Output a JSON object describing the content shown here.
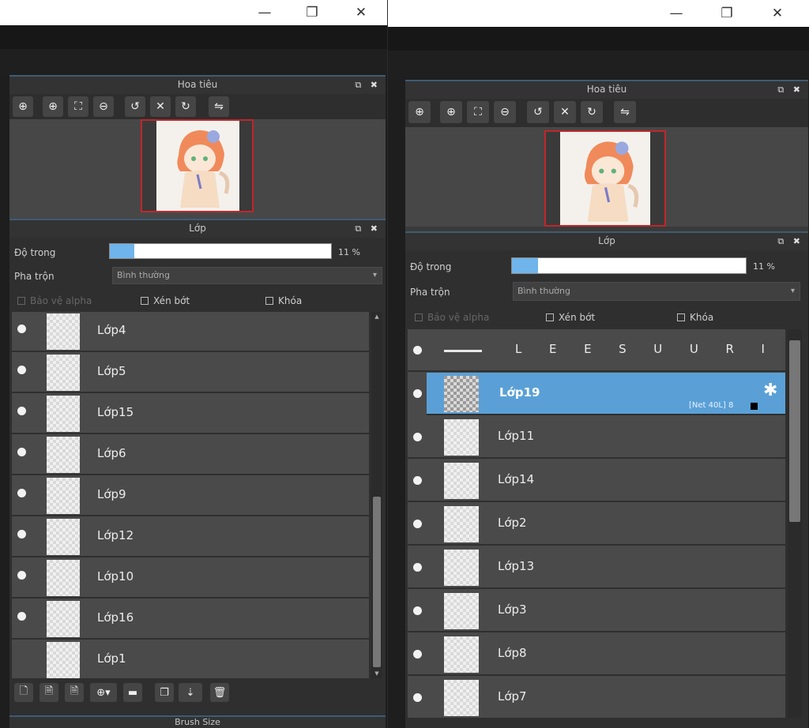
{
  "window_controls": {
    "minimize": "—",
    "maximize": "❐",
    "close": "✕"
  },
  "navigator": {
    "title": "Hoa tiêu",
    "panel_buttons": "⧉ ✖",
    "toolbar_icons": [
      "zoom-fit-icon",
      "zoom-in-icon",
      "fit-window-icon",
      "zoom-out-icon",
      "rotate-left-icon",
      "reset-view-icon",
      "rotate-right-icon",
      "flip-icon"
    ]
  },
  "layer_panel": {
    "title": "Lớp",
    "panel_buttons": "⧉ ✖",
    "opacity_label": "Độ trong",
    "opacity_value": "11 %",
    "opacity_fraction": 0.11,
    "blend_label": "Pha trộn",
    "blend_value": "Bình thường",
    "protect_alpha_label": "Bảo vệ alpha",
    "clip_label": "Xén bớt",
    "lock_label": "Khóa"
  },
  "left_layers": [
    "Lớp4",
    "Lớp5",
    "Lớp15",
    "Lớp6",
    "Lớp9",
    "Lớp12",
    "Lớp10",
    "Lớp16",
    "Lớp1"
  ],
  "right_group": {
    "name_letters": [
      "L",
      "E",
      "E",
      "S",
      "U",
      "U",
      "R",
      "I"
    ]
  },
  "right_selected": {
    "name": "Lớp19",
    "meta": "[Net 40L] 8"
  },
  "right_layers": [
    "Lớp11",
    "Lớp14",
    "Lớp2",
    "Lớp13",
    "Lớp3",
    "Lớp8",
    "Lớp7"
  ],
  "bottom_panel_title": "Brush Size",
  "colors": {
    "accent": "#5aa0d6",
    "preview_border": "#c0262b",
    "opacity_fill": "#6fb4ea"
  }
}
